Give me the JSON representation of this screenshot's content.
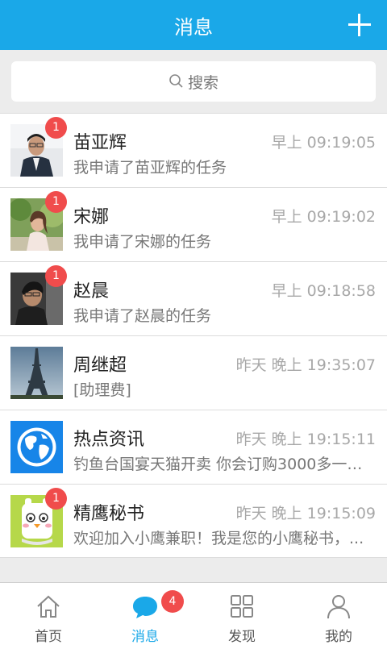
{
  "header": {
    "title": "消息"
  },
  "search": {
    "placeholder": "搜索"
  },
  "conversations": [
    {
      "name": "苗亚辉",
      "time": "早上 09:19:05",
      "preview": "我申请了苗亚辉的任务",
      "badge": "1"
    },
    {
      "name": "宋娜",
      "time": "早上 09:19:02",
      "preview": "我申请了宋娜的任务",
      "badge": "1"
    },
    {
      "name": "赵晨",
      "time": "早上 09:18:58",
      "preview": "我申请了赵晨的任务",
      "badge": "1"
    },
    {
      "name": "周继超",
      "time": "昨天  晚上 19:35:07",
      "preview": "[助理费]",
      "badge": ""
    },
    {
      "name": "热点资讯",
      "time": "昨天  晚上 19:15:11",
      "preview": "钓鱼台国宴天猫开卖 你会订购3000多一份...",
      "badge": ""
    },
    {
      "name": "精鹰秘书",
      "time": "昨天  晚上 19:15:09",
      "preview": "欢迎加入小鹰兼职！我是您的小鹰秘书，...",
      "badge": "1"
    }
  ],
  "tabs": [
    {
      "label": "首页",
      "icon": "home-icon"
    },
    {
      "label": "消息",
      "icon": "chat-icon",
      "badge": "4",
      "active": true
    },
    {
      "label": "发现",
      "icon": "grid-icon"
    },
    {
      "label": "我的",
      "icon": "person-icon"
    }
  ],
  "colors": {
    "brand": "#1aa8e8",
    "badge": "#f04c4c"
  }
}
